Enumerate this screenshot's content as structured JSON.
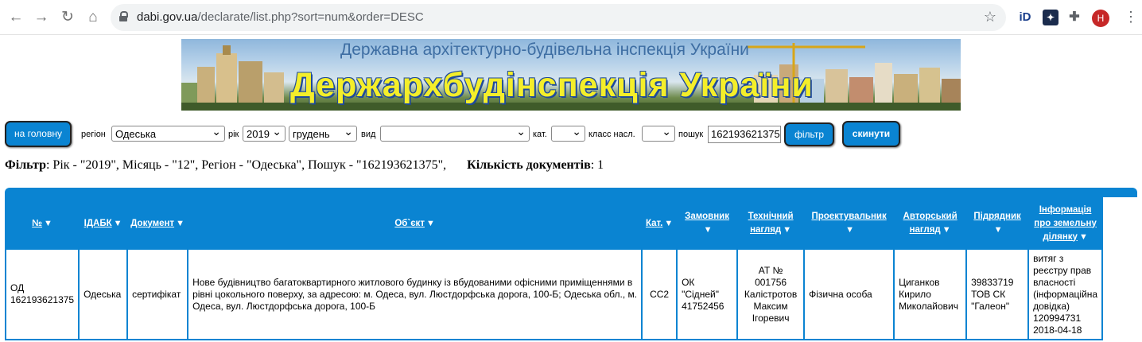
{
  "browser": {
    "url_domain": "dabi.gov.ua",
    "url_path": "/declarate/list.php?sort=num&order=DESC",
    "avatar_letter": "H"
  },
  "banner": {
    "subtitle": "Державна архітектурно-будівельна інспекція України",
    "title": "Держархбудінспекція України"
  },
  "controls": {
    "home_label": "на головну",
    "region_label": "регіон",
    "region_value": "Одеська",
    "year_label": "рік",
    "year_value": "2019",
    "month_value": "грудень",
    "type_label": "вид",
    "type_value": "",
    "cat_label": "кат.",
    "cat_value": "",
    "class_label": "класс насл.",
    "class_value": "",
    "search_label": "пошук",
    "search_value": "162193621375",
    "filter_button": "фільтр",
    "reset_button": "скинути"
  },
  "filter_info": {
    "filter_label": "Фільтр",
    "filter_text": ": Рік - \"2019\", Місяць - \"12\", Регіон - \"Одеська\", Пошук - \"162193621375\",",
    "count_label": "Кількість документів",
    "count_value": ": 1"
  },
  "table": {
    "headers": [
      "№",
      "ІДАБК",
      "Документ",
      "Об`єкт",
      "Кат.",
      "Замовник",
      "Технічний нагляд",
      "Проектувальник",
      "Авторський нагляд",
      "Підрядник",
      "Інформація про земельну ділянку"
    ],
    "row": {
      "num": "ОД 162193621375",
      "idabk": "Одеська",
      "document": "сертифікат",
      "object": "Нове будівництво багатоквартирного житлового будинку із вбудованими офісними приміщеннями в рівні цокольного поверху, за адресою: м. Одеса, вул. Люстдорфська дорога, 100-Б; Одеська обл., м. Одеса, вул. Люстдорфська дорога, 100-Б",
      "cat": "СС2",
      "customer": "ОК \"Сідней\" 41752456",
      "tech_supervision": "АТ № 001756 Калістротов Максим Ігоревич",
      "designer": "Фізична особа",
      "author_supervision": "Циганков Кирило Миколайович",
      "contractor": "39833719 ТОВ СК \"Галеон\"",
      "land_info": "витяг з реєстру прав власності (інформаційна довідка) 120994731 2018-04-18"
    }
  }
}
